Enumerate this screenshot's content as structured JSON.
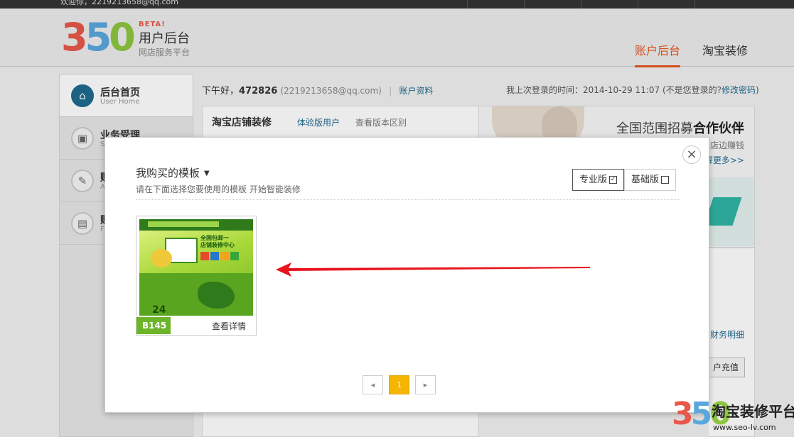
{
  "topbar": {
    "welcome": "欢迎你，2219213658@qq.com"
  },
  "logo": {
    "digit1": "3",
    "digit2": "5",
    "digit3": "0",
    "beta": "BETA!",
    "title": "用户后台",
    "subtitle": "网店服务平台"
  },
  "nav": {
    "tabs": [
      {
        "label": "账户后台",
        "active": true
      },
      {
        "label": "淘宝装修",
        "active": false
      }
    ]
  },
  "sidebar": {
    "items": [
      {
        "label": "后台首页",
        "sub": "User Home",
        "icon": "home-icon",
        "active": true
      },
      {
        "label": "业务受理",
        "sub": "S",
        "icon": "service-icon"
      },
      {
        "label": "财",
        "sub": "A",
        "icon": "edit-icon"
      },
      {
        "label": "财",
        "sub": "F",
        "icon": "briefcase-icon"
      }
    ]
  },
  "greeting": {
    "text": "下午好，",
    "user": "472826",
    "email": "(2219213658@qq.com)",
    "sep": "|",
    "profile_link": "账户资料"
  },
  "last_login": {
    "text": "我上次登录的时间：2014-10-29 11:07 (不是您登录的?",
    "link": "修改密码",
    "close": ")"
  },
  "shop_card": {
    "title": "淘宝店铺装修",
    "trial": "体验版用户",
    "compare": "查看版本区别"
  },
  "banner": {
    "title_prefix": "全国范围招募",
    "title_bold": "合作伙伴",
    "sub": "店边赚钱",
    "more": "解更多>>"
  },
  "finance": {
    "link": "财务明细",
    "recharge": "户充值"
  },
  "modal": {
    "title": "我购买的模板",
    "subtitle": "请在下面选择您要使用的模板 开始智能装修",
    "versions": [
      {
        "label": "专业版",
        "checked": true
      },
      {
        "label": "基础版",
        "checked": false
      }
    ],
    "close": "×",
    "templates": [
      {
        "code": "B145",
        "detail": "查看详情",
        "thumb_headline": "全国包邮一",
        "thumb_headline2": "店铺装修中心",
        "thumb_phone": "24"
      }
    ],
    "pager": {
      "prev": "◂",
      "current": "1",
      "next": "▸"
    }
  },
  "colors": {
    "accent": "#e8541e",
    "link": "#1f6b8f",
    "pager_current": "#f5b500",
    "template_badge": "#6cb52a",
    "arrow": "#e8141e"
  },
  "watermark": {
    "digit1": "3",
    "digit2": "5",
    "digit3": "0",
    "name": "淘宝装修平台",
    "url": "www.seo-lv.com"
  }
}
